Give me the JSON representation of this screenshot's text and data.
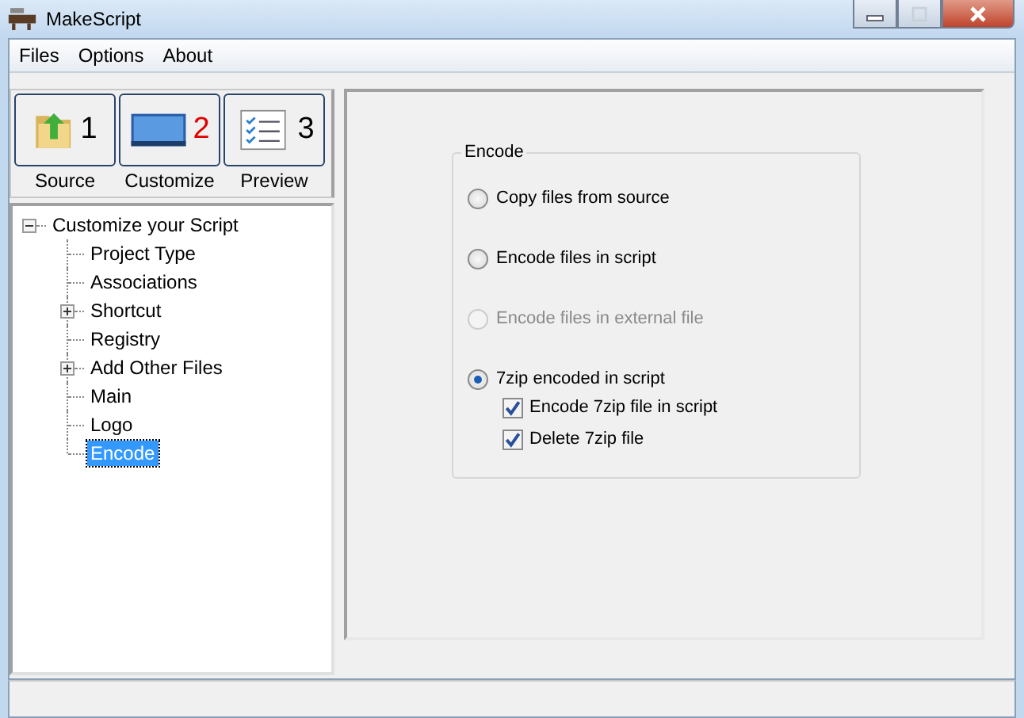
{
  "window": {
    "title": "MakeScript"
  },
  "menu": [
    "Files",
    "Options",
    "About"
  ],
  "steps": [
    {
      "kind": "folder",
      "number": "1",
      "label": "Source",
      "selected": false
    },
    {
      "kind": "monitor",
      "number": "2",
      "label": "Customize",
      "selected": true
    },
    {
      "kind": "checklist",
      "number": "3",
      "label": "Preview",
      "selected": false
    }
  ],
  "tree": {
    "label": "Customize your Script",
    "expanded": true,
    "children": [
      {
        "label": "Project Type",
        "expandable": false,
        "selected": false
      },
      {
        "label": "Associations",
        "expandable": false,
        "selected": false
      },
      {
        "label": "Shortcut",
        "expandable": true,
        "selected": false
      },
      {
        "label": "Registry",
        "expandable": false,
        "selected": false
      },
      {
        "label": "Add Other Files",
        "expandable": true,
        "selected": false
      },
      {
        "label": "Main",
        "expandable": false,
        "selected": false
      },
      {
        "label": "Logo",
        "expandable": false,
        "selected": false
      },
      {
        "label": "Encode",
        "expandable": false,
        "selected": true
      }
    ]
  },
  "group": {
    "title": "Encode",
    "options": [
      {
        "label": "Copy files from source",
        "selected": false,
        "disabled": false
      },
      {
        "label": "Encode files in script",
        "selected": false,
        "disabled": false
      },
      {
        "label": "Encode files in external file",
        "selected": false,
        "disabled": true
      },
      {
        "label": "7zip encoded in script",
        "selected": true,
        "disabled": false,
        "sub": [
          {
            "label": "Encode 7zip file in script",
            "checked": true
          },
          {
            "label": "Delete 7zip file",
            "checked": true
          }
        ]
      }
    ]
  }
}
